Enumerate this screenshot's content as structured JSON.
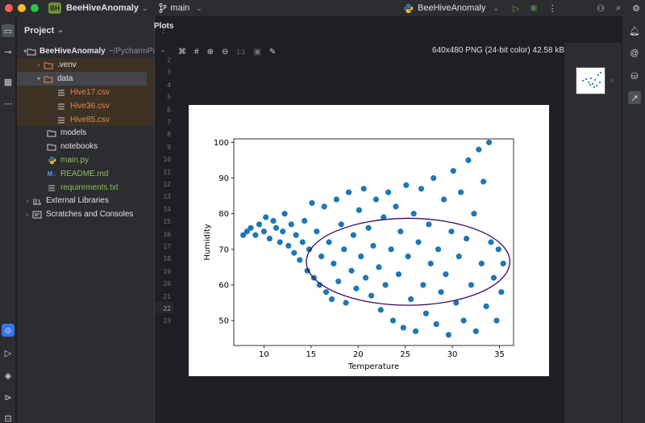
{
  "titlebar": {
    "project_badge": "BH",
    "project_name": "BeeHiveAnomaly",
    "branch": "main",
    "run_config": "BeeHiveAnomaly",
    "traffic_colors": [
      "#ff5f57",
      "#febc2e",
      "#28c840"
    ]
  },
  "project_panel": {
    "title": "Project",
    "root_name": "BeeHiveAnomaly",
    "root_path": "~/PycharmPr",
    "items": [
      {
        "label": ".venv"
      },
      {
        "label": "data"
      },
      {
        "label": "Hive17.csv"
      },
      {
        "label": "Hive36.csv"
      },
      {
        "label": "Hive85.csv"
      },
      {
        "label": "models"
      },
      {
        "label": "notebooks"
      },
      {
        "label": "main.py"
      },
      {
        "label": "README.md"
      },
      {
        "label": "requirements.txt"
      },
      {
        "label": "External Libraries"
      },
      {
        "label": "Scratches and Consoles"
      }
    ]
  },
  "editor": {
    "line_numbers": [
      "2",
      "3",
      "4",
      "5",
      "6",
      "7",
      "8",
      "9",
      "10",
      "11",
      "12",
      "13",
      "14",
      "15",
      "16",
      "17",
      "18",
      "19",
      "20",
      "21",
      "22",
      "23"
    ],
    "current_line": "22"
  },
  "plots": {
    "tab_label": "Plots",
    "zoom_label": "1:1",
    "image_info": "640x480 PNG (24-bit color) 42.58 kB"
  },
  "chart_data": {
    "type": "scatter",
    "xlabel": "Temperature",
    "ylabel": "Humidity",
    "xlim": [
      6.8,
      36.5
    ],
    "ylim": [
      43,
      101
    ],
    "xticks": [
      10,
      15,
      20,
      25,
      30,
      35
    ],
    "yticks": [
      50,
      60,
      70,
      80,
      90,
      100
    ],
    "point_color": "#1f77b4",
    "ellipse_color": "#3d0a5e",
    "ellipse": {
      "center": [
        25.3,
        66.5
      ],
      "x_radius": 10.8,
      "y_radius": 12.2
    },
    "series": [
      {
        "values": [
          [
            7.8,
            74
          ],
          [
            8.2,
            75
          ],
          [
            8.6,
            76
          ],
          [
            9.1,
            74
          ],
          [
            9.5,
            77
          ],
          [
            10.0,
            75
          ],
          [
            10.2,
            79
          ],
          [
            10.6,
            73
          ],
          [
            11.0,
            78
          ],
          [
            11.3,
            76
          ],
          [
            11.7,
            72
          ],
          [
            12.0,
            75
          ],
          [
            12.2,
            80
          ],
          [
            12.6,
            71
          ],
          [
            12.9,
            77
          ],
          [
            13.2,
            69
          ],
          [
            13.4,
            74
          ],
          [
            13.8,
            67
          ],
          [
            14.1,
            72
          ],
          [
            14.3,
            78
          ],
          [
            14.6,
            64
          ],
          [
            14.8,
            70
          ],
          [
            15.1,
            83
          ],
          [
            15.3,
            62
          ],
          [
            15.6,
            75
          ],
          [
            15.9,
            60
          ],
          [
            16.1,
            68
          ],
          [
            16.4,
            82
          ],
          [
            16.6,
            58
          ],
          [
            16.9,
            72
          ],
          [
            17.2,
            56
          ],
          [
            17.4,
            66
          ],
          [
            17.7,
            84
          ],
          [
            17.9,
            61
          ],
          [
            18.2,
            77
          ],
          [
            18.5,
            70
          ],
          [
            18.7,
            55
          ],
          [
            19.0,
            86
          ],
          [
            19.3,
            64
          ],
          [
            19.5,
            74
          ],
          [
            19.8,
            59
          ],
          [
            20.1,
            81
          ],
          [
            20.3,
            68
          ],
          [
            20.6,
            87
          ],
          [
            20.8,
            62
          ],
          [
            21.1,
            76
          ],
          [
            21.4,
            57
          ],
          [
            21.6,
            71
          ],
          [
            21.9,
            84
          ],
          [
            22.2,
            65
          ],
          [
            22.4,
            53
          ],
          [
            22.7,
            79
          ],
          [
            22.9,
            60
          ],
          [
            23.2,
            86
          ],
          [
            23.5,
            70
          ],
          [
            23.7,
            50
          ],
          [
            24.0,
            82
          ],
          [
            24.3,
            63
          ],
          [
            24.5,
            75
          ],
          [
            24.8,
            48
          ],
          [
            25.1,
            88
          ],
          [
            25.3,
            68
          ],
          [
            25.6,
            56
          ],
          [
            25.9,
            80
          ],
          [
            26.1,
            47
          ],
          [
            26.4,
            72
          ],
          [
            26.7,
            87
          ],
          [
            26.9,
            60
          ],
          [
            27.2,
            52
          ],
          [
            27.5,
            77
          ],
          [
            27.7,
            66
          ],
          [
            28.0,
            90
          ],
          [
            28.3,
            49
          ],
          [
            28.5,
            70
          ],
          [
            28.8,
            58
          ],
          [
            29.1,
            84
          ],
          [
            29.3,
            63
          ],
          [
            29.6,
            46
          ],
          [
            29.9,
            75
          ],
          [
            30.1,
            92
          ],
          [
            30.4,
            55
          ],
          [
            30.7,
            68
          ],
          [
            30.9,
            86
          ],
          [
            31.2,
            50
          ],
          [
            31.5,
            73
          ],
          [
            31.7,
            95
          ],
          [
            32.0,
            60
          ],
          [
            32.3,
            80
          ],
          [
            32.5,
            47
          ],
          [
            32.8,
            98
          ],
          [
            33.1,
            66
          ],
          [
            33.3,
            89
          ],
          [
            33.6,
            54
          ],
          [
            33.9,
            100
          ],
          [
            34.1,
            72
          ],
          [
            34.4,
            62
          ],
          [
            34.7,
            50
          ],
          [
            34.9,
            70
          ],
          [
            35.2,
            58
          ],
          [
            35.4,
            66
          ]
        ]
      }
    ]
  }
}
